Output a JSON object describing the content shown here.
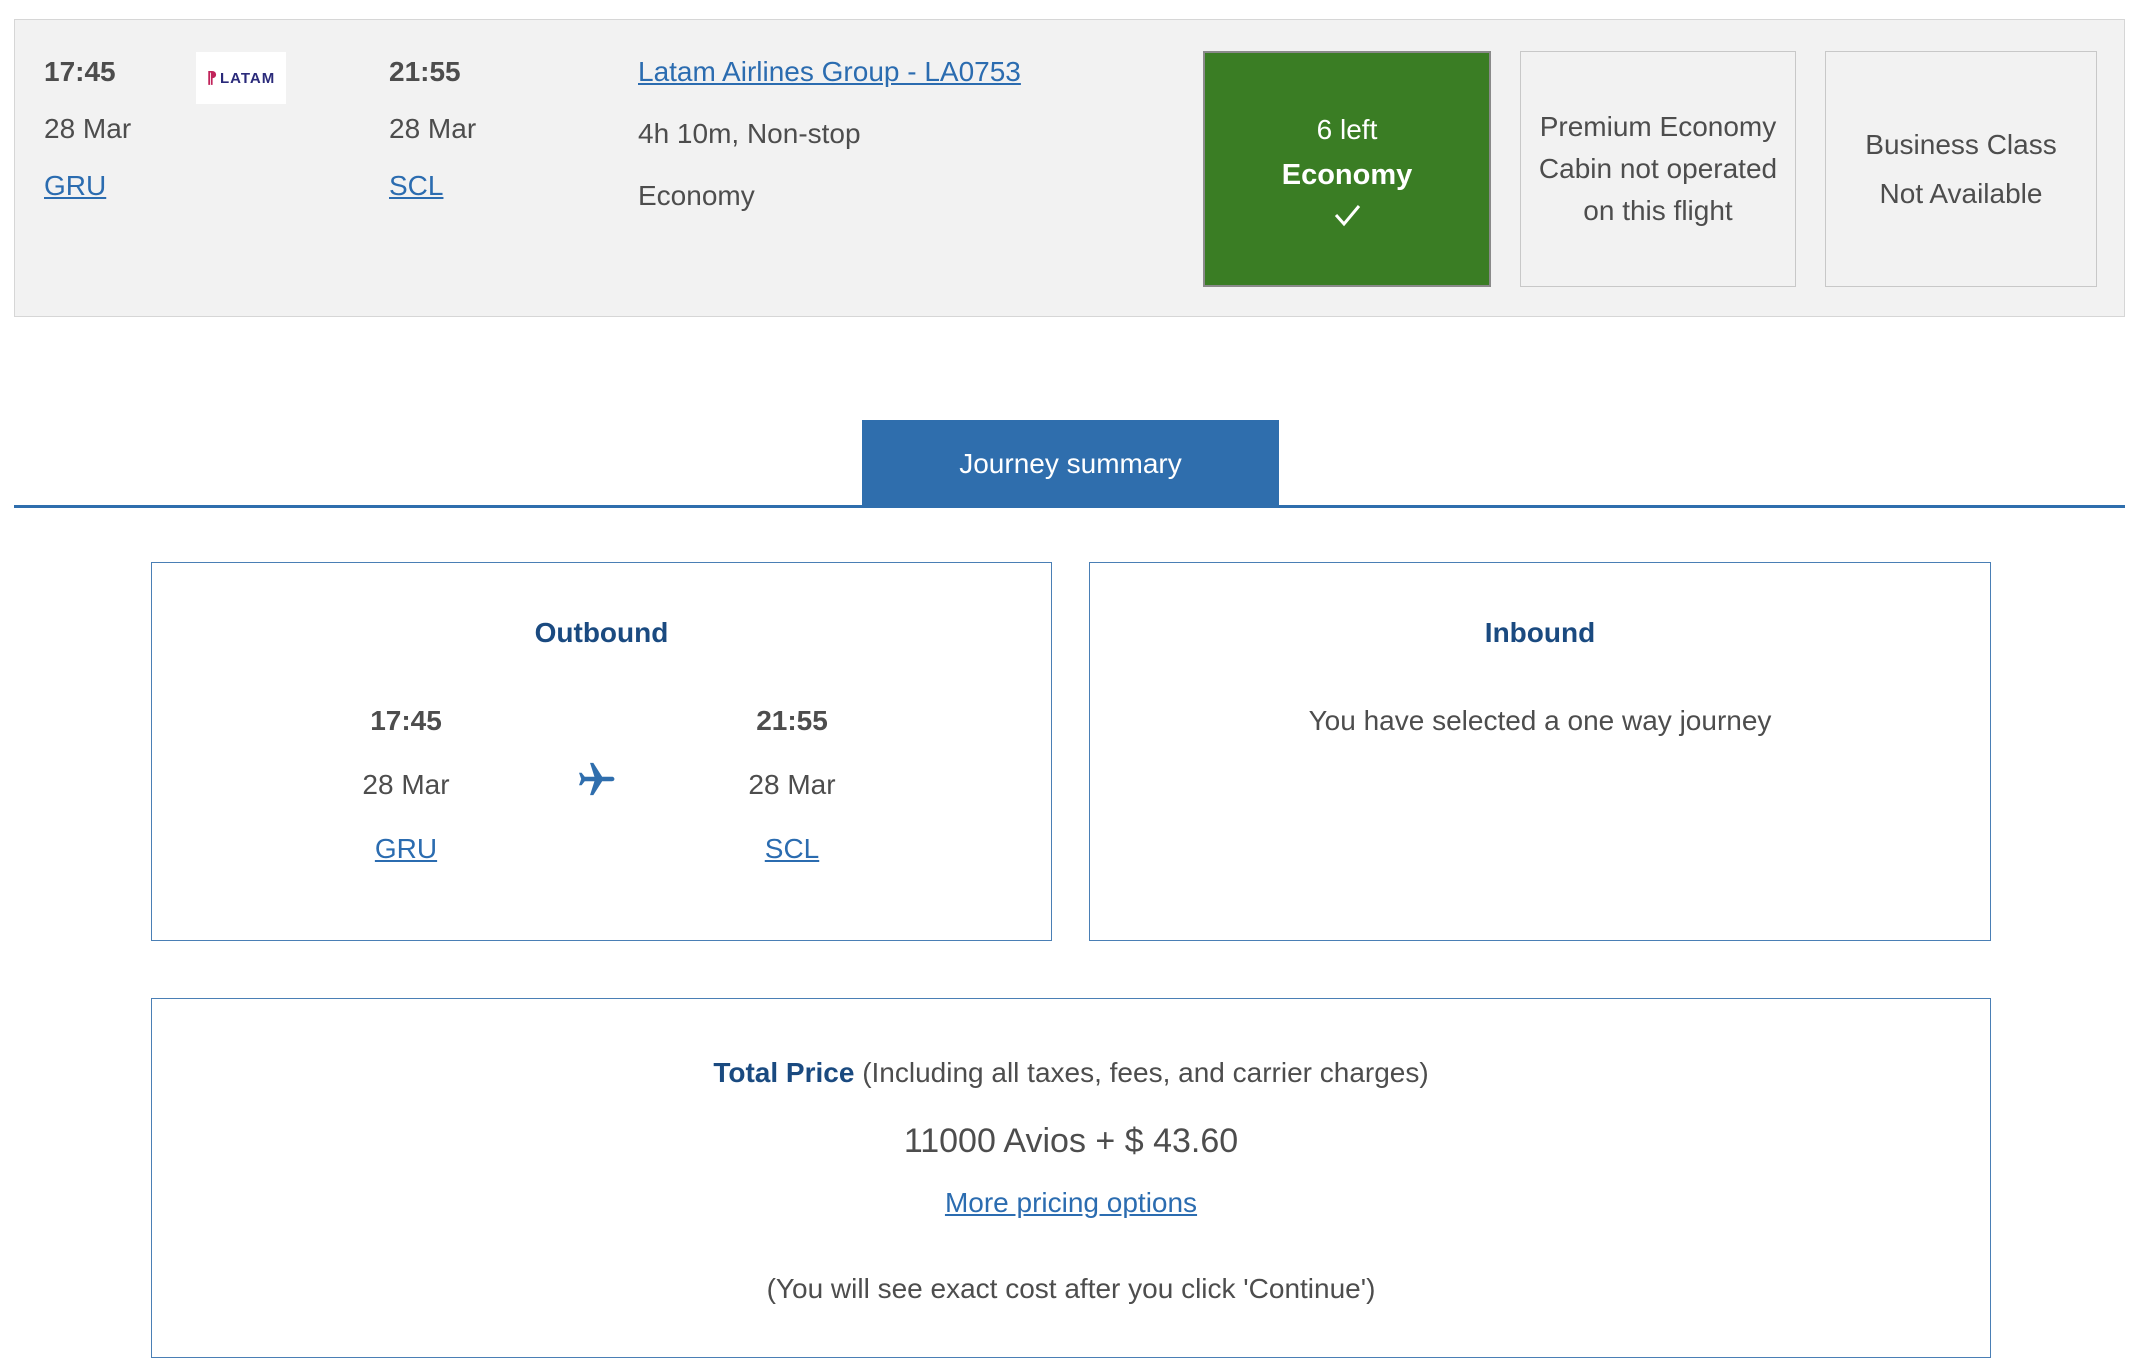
{
  "flight": {
    "departure": {
      "time": "17:45",
      "date": "28 Mar",
      "airport": "GRU"
    },
    "arrival": {
      "time": "21:55",
      "date": "28 Mar",
      "airport": "SCL"
    },
    "airline_logo_text": "LATAM",
    "carrier_link": "Latam Airlines Group - LA0753",
    "duration": "4h 10m, Non-stop",
    "cabin": "Economy",
    "fares": {
      "economy": {
        "availability": "6 left",
        "cabin": "Economy",
        "selected": true
      },
      "premium": {
        "line1": "Premium Economy",
        "line2": "Cabin not operated",
        "line3": "on this flight"
      },
      "business": {
        "line1": "Business Class",
        "line2": "Not Available"
      }
    }
  },
  "tabs": {
    "journey_summary": "Journey summary"
  },
  "outbound": {
    "title": "Outbound",
    "departure": {
      "time": "17:45",
      "date": "28 Mar",
      "airport": "GRU"
    },
    "arrival": {
      "time": "21:55",
      "date": "28 Mar",
      "airport": "SCL"
    }
  },
  "inbound": {
    "title": "Inbound",
    "message": "You have selected a one way journey"
  },
  "price": {
    "heading_bold": "Total Price",
    "heading_rest": "(Including all taxes, fees, and carrier charges)",
    "value": "11000 Avios + $ 43.60",
    "more_options": "More pricing options",
    "note": "(You will see exact cost after you click 'Continue')"
  },
  "colors": {
    "selected_fare": "#3a7d24",
    "accent_blue": "#2f6ead",
    "link": "#2b6cb0",
    "heading_blue": "#1a4a80"
  }
}
